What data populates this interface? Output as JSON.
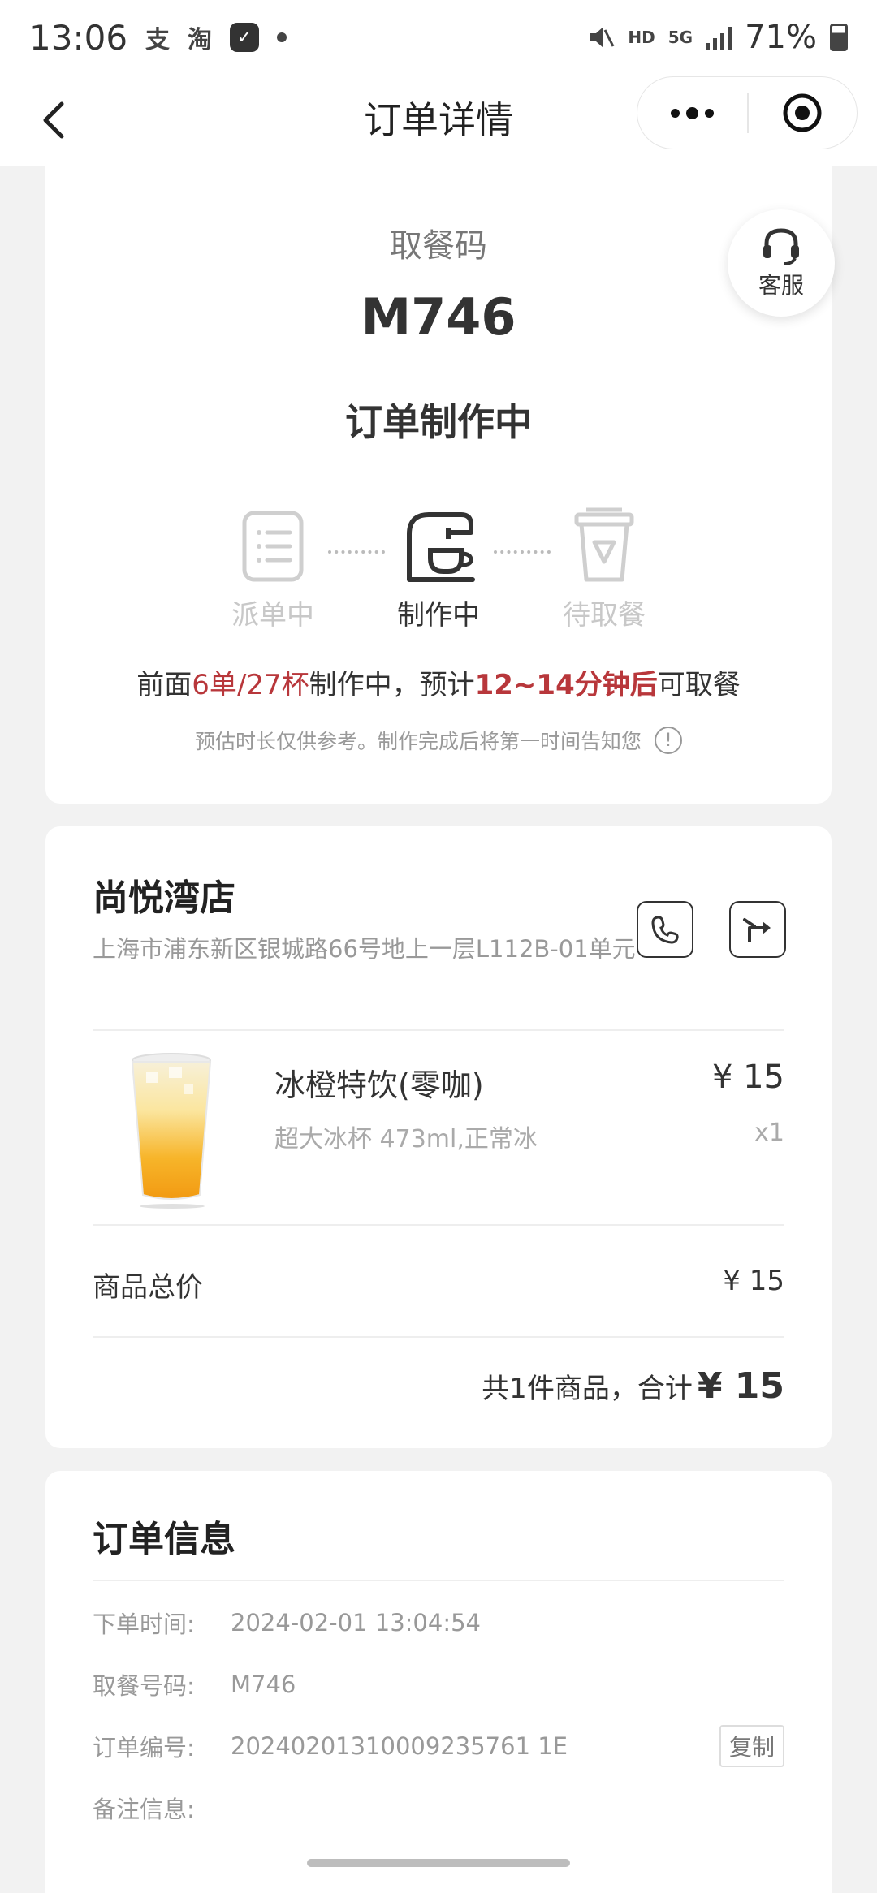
{
  "status_bar": {
    "time": "13:06",
    "app_icons": [
      "支",
      "淘"
    ],
    "hd": "HD",
    "network": "5G",
    "battery": "71%"
  },
  "nav": {
    "title": "订单详情"
  },
  "pickup": {
    "label": "取餐码",
    "code": "M746",
    "status": "订单制作中",
    "service_label": "客服",
    "steps": [
      {
        "label": "派单中",
        "state": "done"
      },
      {
        "label": "制作中",
        "state": "active"
      },
      {
        "label": "待取餐",
        "state": "pending"
      }
    ],
    "eta": {
      "prefix": "前面",
      "queue": "6单/27杯",
      "middle": "制作中，预计",
      "time": "12~14分钟后",
      "suffix": "可取餐"
    },
    "note": "预估时长仅供参考。制作完成后将第一时间告知您",
    "info_icon": "!"
  },
  "store": {
    "name": "尚悦湾店",
    "address": "上海市浦东新区银城路66号地上一层L112B-01单元",
    "product": {
      "name": "冰橙特饮(零咖)",
      "spec": "超大冰杯 473ml,正常冰",
      "price": "¥ 15",
      "qty": "x1"
    },
    "subtotal_label": "商品总价",
    "subtotal_value": "¥ 15",
    "total_text": "共1件商品，合计",
    "total_amount": "¥ 15"
  },
  "order_info": {
    "title": "订单信息",
    "rows": [
      {
        "key": "下单时间:",
        "value": "2024-02-01 13:04:54"
      },
      {
        "key": "取餐号码:",
        "value": "M746"
      },
      {
        "key": "订单编号:",
        "value": "20240201310009235761 1E"
      },
      {
        "key": "备注信息:",
        "value": ""
      }
    ],
    "copy_label": "复制"
  },
  "colors": {
    "accent": "#b8373b",
    "background": "#f2f2f2",
    "card": "#ffffff"
  }
}
